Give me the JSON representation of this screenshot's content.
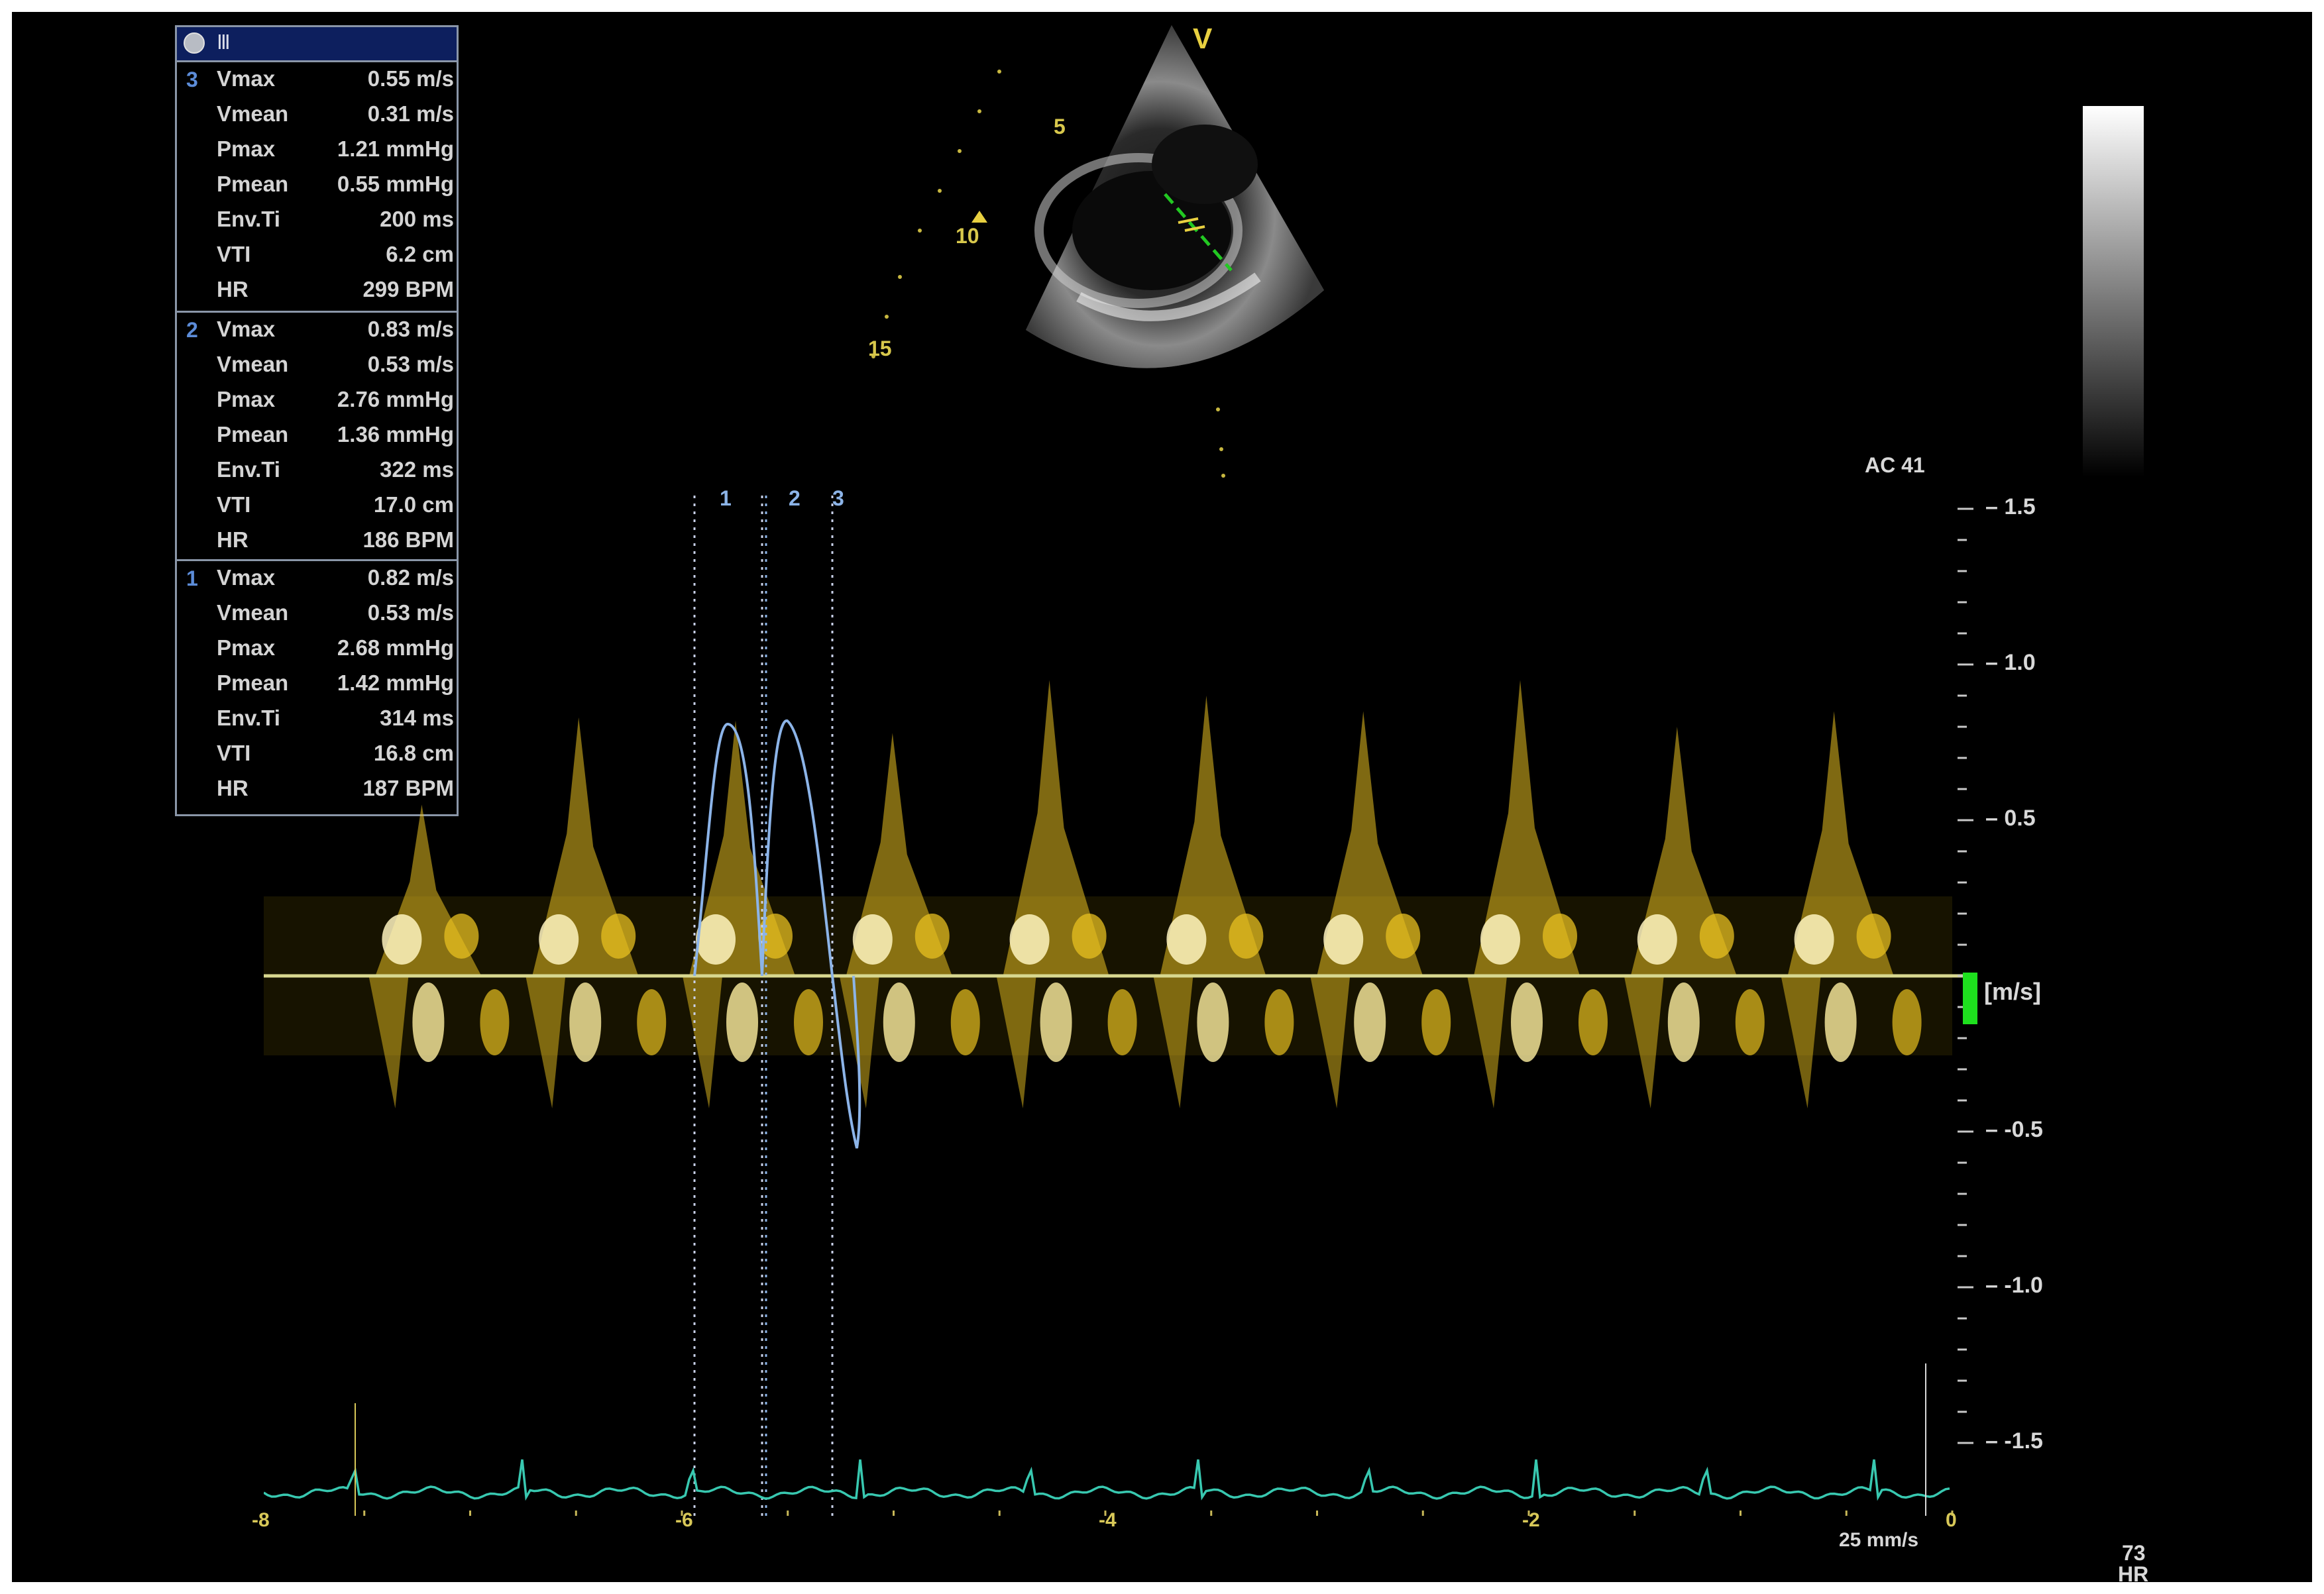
{
  "window": {
    "header_label": "Ⅲ"
  },
  "measurements": [
    {
      "number": "3",
      "rows": [
        {
          "name": "Vmax",
          "value": "0.55 m/s"
        },
        {
          "name": "Vmean",
          "value": "0.31 m/s"
        },
        {
          "name": "Pmax",
          "value": "1.21 mmHg"
        },
        {
          "name": "Pmean",
          "value": "0.55 mmHg"
        },
        {
          "name": "Env.Ti",
          "value": "200 ms"
        },
        {
          "name": "VTI",
          "value": "6.2 cm"
        },
        {
          "name": "HR",
          "value": "299 BPM"
        }
      ]
    },
    {
      "number": "2",
      "rows": [
        {
          "name": "Vmax",
          "value": "0.83 m/s"
        },
        {
          "name": "Vmean",
          "value": "0.53 m/s"
        },
        {
          "name": "Pmax",
          "value": "2.76 mmHg"
        },
        {
          "name": "Pmean",
          "value": "1.36 mmHg"
        },
        {
          "name": "Env.Ti",
          "value": "322 ms"
        },
        {
          "name": "VTI",
          "value": "17.0 cm"
        },
        {
          "name": "HR",
          "value": "186 BPM"
        }
      ]
    },
    {
      "number": "1",
      "rows": [
        {
          "name": "Vmax",
          "value": "0.82 m/s"
        },
        {
          "name": "Vmean",
          "value": "0.53 m/s"
        },
        {
          "name": "Pmax",
          "value": "2.68 mmHg"
        },
        {
          "name": "Pmean",
          "value": "1.42 mmHg"
        },
        {
          "name": "Env.Ti",
          "value": "314 ms"
        },
        {
          "name": "VTI",
          "value": "16.8 cm"
        },
        {
          "name": "HR",
          "value": "187 BPM"
        }
      ]
    }
  ],
  "echo2d": {
    "marker": "V",
    "depth_labels": [
      "5",
      "10",
      "15"
    ]
  },
  "doppler": {
    "ac_label": "AC 41",
    "units": "[m/s]",
    "velocity_ticks": [
      "1.5",
      "1.0",
      "0.5",
      "-0.5",
      "-1.0",
      "-1.5"
    ],
    "time_ticks": [
      "-8",
      "-6",
      "-4",
      "-2",
      "0"
    ],
    "caliper_labels": [
      "1",
      "2",
      "3"
    ],
    "sweep_speed": "25 mm/s",
    "hr_value": "73",
    "hr_label": "HR"
  },
  "colors": {
    "spectrum": "#e8c020",
    "baseline": "#d8d890",
    "ecg": "#38c8b0",
    "caliper": "#8cb4e8",
    "text": "#d8d8d8"
  },
  "chart_data": {
    "type": "line",
    "xlabel": "",
    "ylabel": "[m/s]",
    "xlim": [
      -8,
      0
    ],
    "ylim": [
      -1.5,
      1.5
    ],
    "x_ticks": [
      -8,
      -6,
      -4,
      -2,
      0
    ],
    "y_ticks": [
      1.5,
      1.0,
      0.5,
      -0.5,
      -1.0,
      -1.5
    ],
    "baseline": 0,
    "peak_velocities_forward": [
      0.55,
      0.83,
      0.82,
      0.78,
      0.95,
      0.9,
      0.85,
      0.95,
      0.8,
      0.85
    ]
  }
}
